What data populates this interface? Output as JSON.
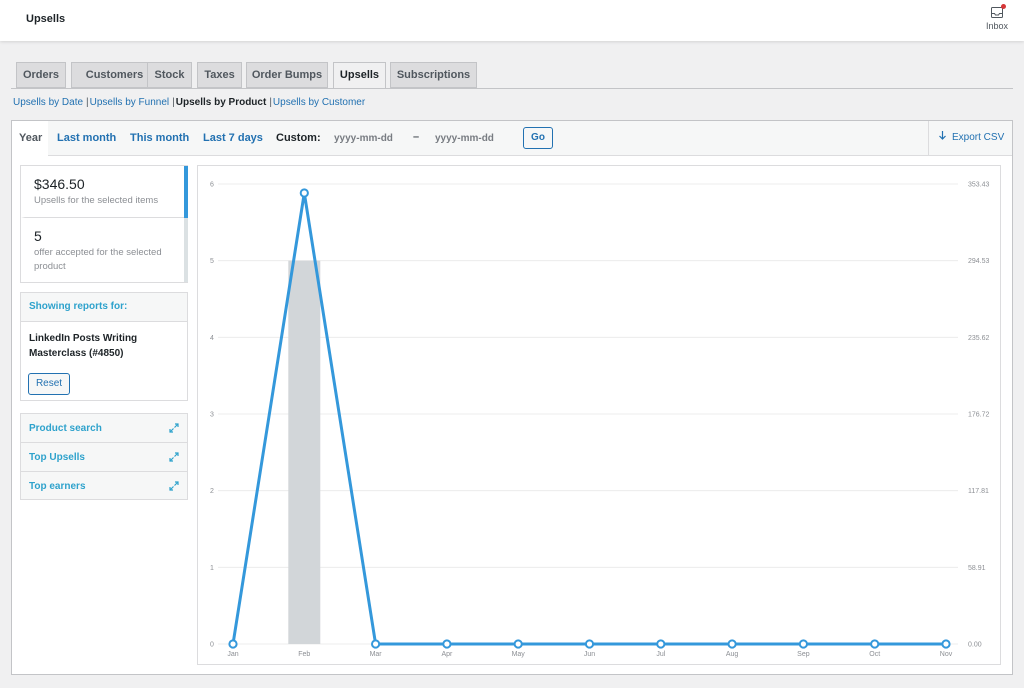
{
  "header": {
    "title": "Upsells",
    "inbox_label": "Inbox"
  },
  "tabs": [
    {
      "label": "Orders",
      "active": false
    },
    {
      "label": "Customers",
      "active": false
    },
    {
      "label": "Stock",
      "active": false
    },
    {
      "label": "Taxes",
      "active": false
    },
    {
      "label": "Order Bumps",
      "active": false
    },
    {
      "label": "Upsells",
      "active": true
    },
    {
      "label": "Subscriptions",
      "active": false
    }
  ],
  "subnav": [
    {
      "label": "Upsells by Date",
      "current": false
    },
    {
      "label": "Upsells by Funnel",
      "current": false
    },
    {
      "label": "Upsells by Product",
      "current": true
    },
    {
      "label": "Upsells by Customer",
      "current": false
    }
  ],
  "ranges": [
    {
      "label": "Year",
      "active": true
    },
    {
      "label": "Last month",
      "active": false
    },
    {
      "label": "This month",
      "active": false
    },
    {
      "label": "Last 7 days",
      "active": false
    }
  ],
  "custom": {
    "label": "Custom:",
    "start_placeholder": "yyyy-mm-dd",
    "end_placeholder": "yyyy-mm-dd",
    "separator": "–",
    "go_label": "Go"
  },
  "export_label": "Export CSV",
  "legend": [
    {
      "amount": "$346.50",
      "desc": "Upsells for the selected items",
      "color": "#3498db"
    },
    {
      "amount": "5",
      "desc": "offer accepted for the selected product",
      "color": "#dbe1e3"
    }
  ],
  "showing": {
    "heading": "Showing reports for:",
    "product": "LinkedIn Posts Writing Masterclass (#4850)",
    "reset_label": "Reset"
  },
  "widgets": [
    {
      "label": "Product search"
    },
    {
      "label": "Top Upsells"
    },
    {
      "label": "Top earners"
    }
  ],
  "colors": {
    "accent": "#2271b1",
    "line": "#3498db",
    "bar": "#d2d6d9",
    "widget_text": "#2ea2cc"
  },
  "chart_data": {
    "type": "bar+line",
    "categories": [
      "Jan",
      "Feb",
      "Mar",
      "Apr",
      "May",
      "Jun",
      "Jul",
      "Aug",
      "Sep",
      "Oct",
      "Nov"
    ],
    "series": [
      {
        "name": "offer accepted for the selected product",
        "type": "bar",
        "axis": "left",
        "values": [
          0,
          5,
          0,
          0,
          0,
          0,
          0,
          0,
          0,
          0,
          0
        ]
      },
      {
        "name": "Upsells for the selected items",
        "type": "line",
        "axis": "right",
        "values": [
          0,
          346.5,
          0,
          0,
          0,
          0,
          0,
          0,
          0,
          0,
          0
        ]
      }
    ],
    "y_left": {
      "ticks": [
        "0",
        "1",
        "2",
        "3",
        "4",
        "5",
        "6"
      ],
      "lim": [
        0,
        6
      ]
    },
    "y_right": {
      "ticks": [
        "0.00",
        "58.91",
        "117.81",
        "176.72",
        "235.62",
        "294.53",
        "353.43"
      ],
      "lim": [
        0,
        353.43
      ]
    },
    "grid": true
  }
}
